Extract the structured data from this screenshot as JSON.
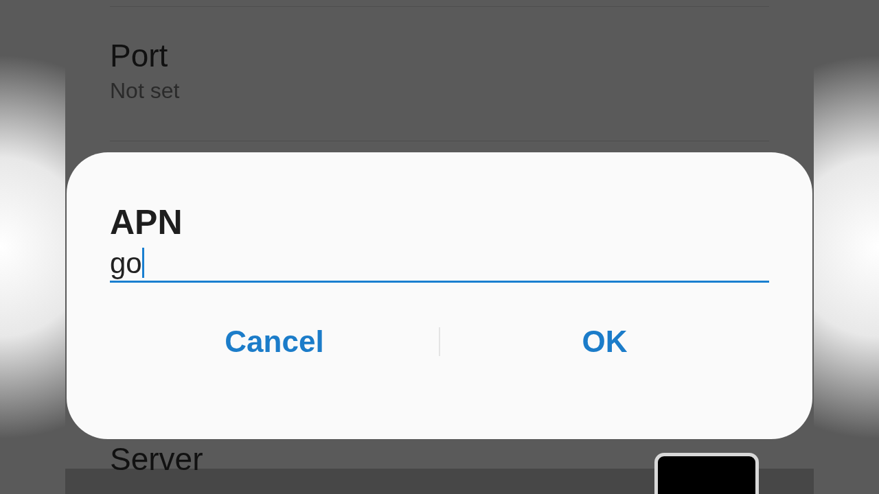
{
  "settings": [
    {
      "title": "Port",
      "summary": "Not set"
    },
    {
      "title": "Server"
    }
  ],
  "dialog": {
    "title": "APN",
    "field": {
      "value": "go",
      "focused": true
    },
    "buttons": [
      {
        "label": "Cancel"
      },
      {
        "label": "OK"
      }
    ]
  }
}
